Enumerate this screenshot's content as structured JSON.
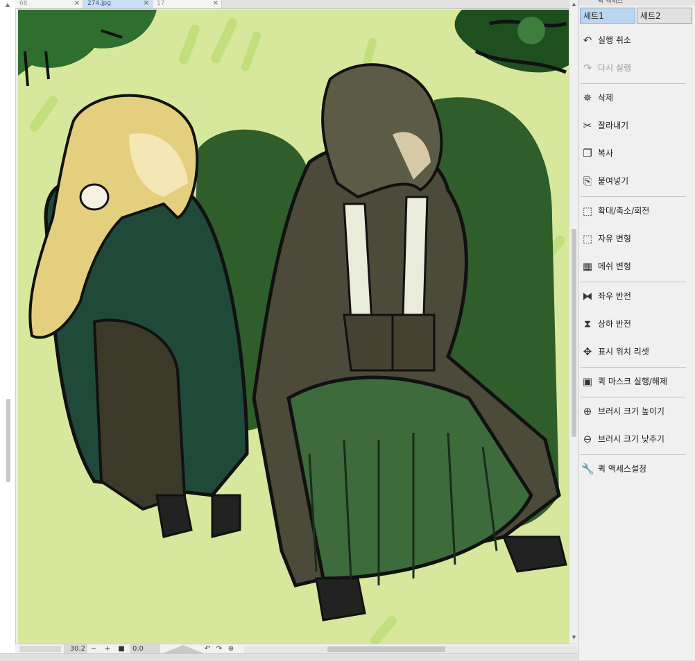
{
  "tabs": [
    {
      "label": "66",
      "active": false
    },
    {
      "label": "274.jpg",
      "active": true
    },
    {
      "label": "17",
      "active": false
    }
  ],
  "statusbar": {
    "zoom": "30.2",
    "zoom_out": "−",
    "zoom_in": "+",
    "angle": "0.0"
  },
  "panel": {
    "title": "퀵 액세스",
    "set_tabs": [
      {
        "label": "세트1",
        "active": true
      },
      {
        "label": "세트2",
        "active": false
      }
    ],
    "items": [
      {
        "label": "실행 취소",
        "icon": "undo-icon",
        "glyph": "↶",
        "enabled": true
      },
      {
        "label": "다시 실행",
        "icon": "redo-icon",
        "glyph": "↷",
        "enabled": false
      },
      {
        "label": "삭제",
        "icon": "delete-icon",
        "glyph": "✵",
        "enabled": true
      },
      {
        "label": "잘라내기",
        "icon": "scissors-icon",
        "glyph": "✂",
        "enabled": true
      },
      {
        "label": "복사",
        "icon": "copy-icon",
        "glyph": "❐",
        "enabled": true
      },
      {
        "label": "붙여넣기",
        "icon": "paste-icon",
        "glyph": "⎘",
        "enabled": true
      },
      {
        "label": "확대/축소/회전",
        "icon": "transform-icon",
        "glyph": "⬚",
        "enabled": true
      },
      {
        "label": "자유 변형",
        "icon": "free-transform-icon",
        "glyph": "⬚",
        "enabled": true
      },
      {
        "label": "메쉬 변형",
        "icon": "mesh-transform-icon",
        "glyph": "▦",
        "enabled": true
      },
      {
        "label": "좌우 반전",
        "icon": "flip-horizontal-icon",
        "glyph": "⧓",
        "enabled": true
      },
      {
        "label": "상하 반전",
        "icon": "flip-vertical-icon",
        "glyph": "⧗",
        "enabled": true
      },
      {
        "label": "표시 위치 리셋",
        "icon": "reset-position-icon",
        "glyph": "✥",
        "enabled": true
      },
      {
        "label": "퀵 마스크 실행/해제",
        "icon": "quick-mask-icon",
        "glyph": "▣",
        "enabled": true
      },
      {
        "label": "브러시 크기 높이기",
        "icon": "brush-size-up-icon",
        "glyph": "⊕",
        "enabled": true
      },
      {
        "label": "브러시 크기 낮추기",
        "icon": "brush-size-down-icon",
        "glyph": "⊖",
        "enabled": true
      },
      {
        "label": "퀵 액세스설정",
        "icon": "wrench-icon",
        "glyph": "🔧",
        "enabled": true
      }
    ]
  },
  "colors": {
    "canvas_bg": "#d7e89c",
    "active_tab": "#c9dff4",
    "active_set": "#bcd6ef"
  }
}
